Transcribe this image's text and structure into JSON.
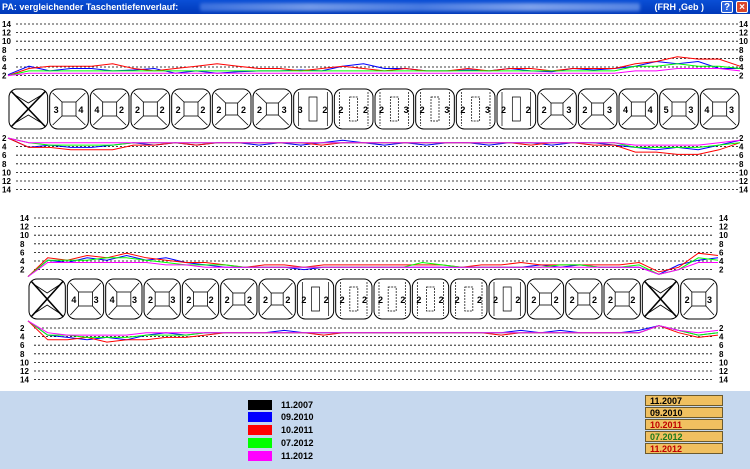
{
  "window": {
    "title": "PA: vergleichender Taschentiefenverlauf:",
    "suffix": "(FRH ,Geb )",
    "help_label": "?",
    "close_label": "×"
  },
  "colors": {
    "series": [
      "#000000",
      "#0000ff",
      "#ff0000",
      "#00ff00",
      "#ff00ff"
    ],
    "background": "#ffffff",
    "bottom_panel": "#c6d8ee",
    "date_box": "#f0c060"
  },
  "legend": [
    {
      "label": "11.2007",
      "color": "#000000"
    },
    {
      "label": "09.2010",
      "color": "#0000ff"
    },
    {
      "label": "10.2011",
      "color": "#ff0000"
    },
    {
      "label": "07.2012",
      "color": "#00ff00"
    },
    {
      "label": "11.2012",
      "color": "#ff00ff"
    }
  ],
  "date_list": [
    {
      "label": "11.2007",
      "color": "#000000"
    },
    {
      "label": "09.2010",
      "color": "#000000"
    },
    {
      "label": "10.2011",
      "color": "#c00000"
    },
    {
      "label": "07.2012",
      "color": "#1e7a1e"
    },
    {
      "label": "11.2012",
      "color": "#c00000"
    }
  ],
  "chart_data": [
    {
      "type": "line",
      "title": "",
      "panel": "upper jaw",
      "y_ticks": [
        "14",
        "12",
        "10",
        "8",
        "6",
        "4",
        "2"
      ],
      "ylim": [
        0,
        14
      ],
      "teeth_shape": [
        "X",
        "molar",
        "molar",
        "molar",
        "molar",
        "premolar",
        "premolar",
        "canine",
        "incisor",
        "incisor",
        "incisor",
        "incisor",
        "canine",
        "premolar",
        "premolar",
        "molar",
        "molar",
        "molar"
      ],
      "teeth_numbers": [
        [
          "",
          ""
        ],
        [
          "3",
          "4"
        ],
        [
          "4",
          "2"
        ],
        [
          "2",
          "2"
        ],
        [
          "2",
          "2"
        ],
        [
          "2",
          "2"
        ],
        [
          "2",
          "3"
        ],
        [
          "3",
          "2"
        ],
        [
          "2",
          "2"
        ],
        [
          "2",
          "3"
        ],
        [
          "2",
          "3"
        ],
        [
          "2",
          "3"
        ],
        [
          "2",
          "2"
        ],
        [
          "2",
          "3"
        ],
        [
          "2",
          "3"
        ],
        [
          "4",
          "4"
        ],
        [
          "5",
          "3"
        ],
        [
          "4",
          "3"
        ]
      ],
      "buccal": [
        {
          "name": "09.2010",
          "values": [
            2.2,
            4.0,
            3.0,
            3.5,
            3.5,
            3.0,
            3.2,
            3.5,
            2.5,
            3.0,
            2.5,
            2.8,
            3.0,
            3.0,
            3.2,
            3.0,
            4.0,
            4.5,
            3.5,
            3.5,
            3.0,
            3.0,
            3.2,
            3.0,
            3.5,
            3.0,
            2.8,
            3.5,
            3.2,
            3.5,
            4.0,
            5.0,
            4.5,
            5.0,
            3.5,
            3.5
          ]
        },
        {
          "name": "10.2011",
          "values": [
            2.0,
            3.5,
            4.0,
            4.0,
            4.0,
            4.5,
            3.5,
            3.0,
            3.5,
            4.0,
            4.5,
            4.0,
            3.5,
            3.5,
            3.0,
            3.5,
            4.0,
            3.5,
            3.0,
            3.5,
            3.0,
            3.0,
            3.5,
            3.0,
            3.5,
            3.5,
            3.0,
            3.5,
            3.5,
            3.5,
            4.5,
            5.0,
            6.0,
            5.5,
            5.5,
            4.0
          ]
        },
        {
          "name": "07.2012",
          "values": [
            2.0,
            3.0,
            3.0,
            3.0,
            3.0,
            3.0,
            3.0,
            3.0,
            3.0,
            3.0,
            3.0,
            3.0,
            3.0,
            3.0,
            3.0,
            3.0,
            3.0,
            3.0,
            3.0,
            3.0,
            3.0,
            3.0,
            3.0,
            3.0,
            3.0,
            3.0,
            3.0,
            3.0,
            3.0,
            3.0,
            4.0,
            4.0,
            4.5,
            4.0,
            4.0,
            3.5
          ]
        },
        {
          "name": "11.2012",
          "values": [
            2.0,
            2.5,
            2.5,
            2.5,
            2.5,
            2.5,
            2.5,
            2.5,
            2.5,
            2.5,
            2.5,
            2.5,
            2.5,
            2.5,
            2.5,
            2.5,
            2.5,
            2.5,
            2.5,
            2.5,
            2.5,
            2.5,
            2.5,
            2.5,
            2.5,
            2.5,
            2.5,
            2.5,
            2.5,
            2.5,
            3.0,
            3.0,
            3.5,
            3.5,
            3.5,
            3.0
          ]
        }
      ],
      "lingual": [
        {
          "name": "09.2010",
          "values": [
            2.0,
            4.0,
            3.5,
            4.0,
            4.0,
            3.5,
            3.0,
            3.5,
            3.0,
            3.5,
            3.0,
            3.0,
            3.5,
            3.0,
            3.5,
            3.0,
            2.5,
            3.0,
            3.5,
            3.0,
            3.5,
            3.0,
            3.0,
            3.5,
            3.0,
            3.0,
            3.5,
            3.0,
            3.0,
            3.5,
            4.0,
            4.5,
            4.0,
            4.5,
            3.5,
            2.5
          ]
        },
        {
          "name": "10.2011",
          "values": [
            2.0,
            4.0,
            4.0,
            4.5,
            4.5,
            4.5,
            3.5,
            3.5,
            3.0,
            3.5,
            3.0,
            3.0,
            3.0,
            3.0,
            3.0,
            3.5,
            3.0,
            3.0,
            3.0,
            3.0,
            3.0,
            3.0,
            3.0,
            3.0,
            3.0,
            3.5,
            3.0,
            3.0,
            3.5,
            3.5,
            5.0,
            5.0,
            5.5,
            5.5,
            4.5,
            3.0
          ]
        },
        {
          "name": "07.2012",
          "values": [
            2.0,
            3.0,
            3.5,
            3.5,
            3.5,
            3.5,
            3.0,
            3.0,
            3.0,
            3.0,
            3.0,
            3.0,
            3.0,
            3.0,
            3.0,
            3.0,
            3.0,
            3.0,
            3.0,
            3.0,
            3.0,
            3.0,
            3.0,
            3.0,
            3.0,
            3.0,
            3.0,
            3.0,
            3.0,
            3.0,
            4.0,
            4.0,
            4.0,
            4.0,
            3.5,
            3.0
          ]
        },
        {
          "name": "11.2012",
          "values": [
            2.0,
            3.0,
            3.0,
            3.0,
            3.0,
            3.0,
            3.0,
            3.0,
            3.0,
            3.0,
            3.0,
            3.0,
            3.0,
            3.0,
            3.0,
            3.0,
            3.0,
            3.0,
            3.0,
            3.0,
            3.0,
            3.0,
            3.0,
            3.0,
            3.0,
            3.0,
            3.0,
            3.0,
            3.0,
            3.0,
            3.5,
            3.5,
            3.5,
            3.5,
            3.0,
            2.5
          ]
        }
      ]
    },
    {
      "type": "line",
      "title": "",
      "panel": "lower jaw",
      "y_ticks": [
        "14",
        "12",
        "10",
        "8",
        "6",
        "4",
        "2"
      ],
      "ylim": [
        0,
        14
      ],
      "teeth_shape": [
        "X",
        "molar",
        "molar",
        "molar",
        "molar",
        "premolar",
        "premolar",
        "canine",
        "incisor",
        "incisor",
        "incisor",
        "incisor",
        "canine",
        "premolar",
        "premolar",
        "molar",
        "X",
        "molar"
      ],
      "teeth_numbers": [
        [
          "",
          ""
        ],
        [
          "4",
          "3"
        ],
        [
          "4",
          "3"
        ],
        [
          "2",
          "3"
        ],
        [
          "2",
          "2"
        ],
        [
          "2",
          "2"
        ],
        [
          "2",
          "2"
        ],
        [
          "2",
          "2"
        ],
        [
          "2",
          "2"
        ],
        [
          "2",
          "2"
        ],
        [
          "2",
          "2"
        ],
        [
          "2",
          "2"
        ],
        [
          "2",
          "2"
        ],
        [
          "2",
          "2"
        ],
        [
          "2",
          "2"
        ],
        [
          "2",
          "2"
        ],
        [
          "",
          ""
        ],
        [
          "2",
          "3"
        ]
      ],
      "buccal": [
        {
          "name": "09.2010",
          "values": [
            0.5,
            4.0,
            3.5,
            4.5,
            4.0,
            5.0,
            4.0,
            4.5,
            3.5,
            3.0,
            2.5,
            2.5,
            2.5,
            2.5,
            2.0,
            2.5,
            2.5,
            2.5,
            2.5,
            2.5,
            2.5,
            2.5,
            2.5,
            2.5,
            2.5,
            2.5,
            3.0,
            2.5,
            3.0,
            2.5,
            2.5,
            2.5,
            1.0,
            3.0,
            4.0,
            4.5
          ]
        },
        {
          "name": "10.2011",
          "values": [
            0.5,
            4.5,
            4.0,
            5.0,
            4.5,
            5.5,
            4.5,
            4.0,
            3.5,
            3.5,
            3.0,
            2.5,
            3.0,
            3.0,
            2.5,
            3.0,
            3.0,
            3.0,
            3.0,
            3.0,
            3.0,
            3.0,
            2.5,
            3.0,
            3.0,
            3.5,
            3.0,
            3.0,
            3.0,
            3.0,
            3.0,
            3.5,
            1.5,
            2.5,
            5.5,
            5.0
          ]
        },
        {
          "name": "07.2012",
          "values": [
            0.5,
            4.0,
            4.0,
            4.0,
            4.5,
            4.5,
            4.0,
            3.5,
            3.0,
            3.0,
            3.0,
            2.5,
            2.5,
            2.5,
            2.5,
            2.5,
            2.5,
            2.5,
            2.5,
            2.5,
            3.5,
            3.0,
            2.5,
            2.5,
            2.5,
            2.5,
            2.5,
            3.0,
            3.0,
            2.5,
            2.5,
            3.0,
            1.0,
            2.0,
            4.5,
            4.0
          ]
        },
        {
          "name": "11.2012",
          "values": [
            0.5,
            3.5,
            3.5,
            3.5,
            3.5,
            3.5,
            3.5,
            3.0,
            3.0,
            2.5,
            2.5,
            2.5,
            2.5,
            2.5,
            2.5,
            2.5,
            2.5,
            2.5,
            2.5,
            2.5,
            2.5,
            2.5,
            2.5,
            2.5,
            2.5,
            2.5,
            2.5,
            2.5,
            2.5,
            2.5,
            2.5,
            2.5,
            1.0,
            2.0,
            3.5,
            3.5
          ]
        }
      ],
      "lingual": [
        {
          "name": "09.2010",
          "values": [
            0.5,
            3.5,
            4.0,
            4.5,
            4.0,
            4.5,
            3.5,
            3.0,
            3.5,
            3.0,
            3.0,
            3.0,
            3.0,
            2.5,
            3.0,
            3.0,
            3.0,
            3.0,
            3.0,
            3.0,
            3.0,
            3.0,
            3.0,
            3.0,
            3.0,
            2.5,
            3.0,
            2.5,
            3.0,
            3.0,
            3.0,
            2.5,
            1.5,
            2.5,
            3.5,
            3.0
          ]
        },
        {
          "name": "10.2011",
          "values": [
            0.5,
            4.5,
            4.5,
            4.0,
            5.0,
            4.5,
            4.5,
            4.0,
            4.0,
            3.5,
            3.0,
            3.0,
            3.0,
            3.0,
            3.0,
            3.5,
            3.0,
            3.0,
            3.0,
            3.0,
            3.0,
            3.0,
            3.0,
            3.0,
            3.5,
            3.0,
            3.0,
            3.0,
            3.0,
            3.0,
            3.0,
            3.0,
            1.5,
            3.0,
            4.0,
            3.5
          ]
        },
        {
          "name": "07.2012",
          "values": [
            0.5,
            3.5,
            3.5,
            4.0,
            4.0,
            4.0,
            3.5,
            3.5,
            3.5,
            3.0,
            3.0,
            3.0,
            3.0,
            3.0,
            3.0,
            3.0,
            3.0,
            3.0,
            3.0,
            3.0,
            3.0,
            3.0,
            3.0,
            3.0,
            3.0,
            3.0,
            3.0,
            3.0,
            3.0,
            3.0,
            3.0,
            3.0,
            1.5,
            2.5,
            3.5,
            3.0
          ]
        },
        {
          "name": "11.2012",
          "values": [
            0.5,
            3.0,
            3.5,
            3.5,
            3.5,
            3.5,
            3.0,
            3.0,
            3.0,
            3.0,
            3.0,
            3.0,
            3.0,
            3.0,
            3.0,
            3.0,
            3.0,
            3.0,
            3.0,
            3.0,
            3.0,
            3.0,
            3.0,
            3.0,
            3.0,
            3.0,
            3.0,
            3.0,
            3.0,
            3.0,
            3.0,
            3.0,
            1.5,
            2.5,
            3.0,
            2.5
          ]
        }
      ]
    }
  ]
}
